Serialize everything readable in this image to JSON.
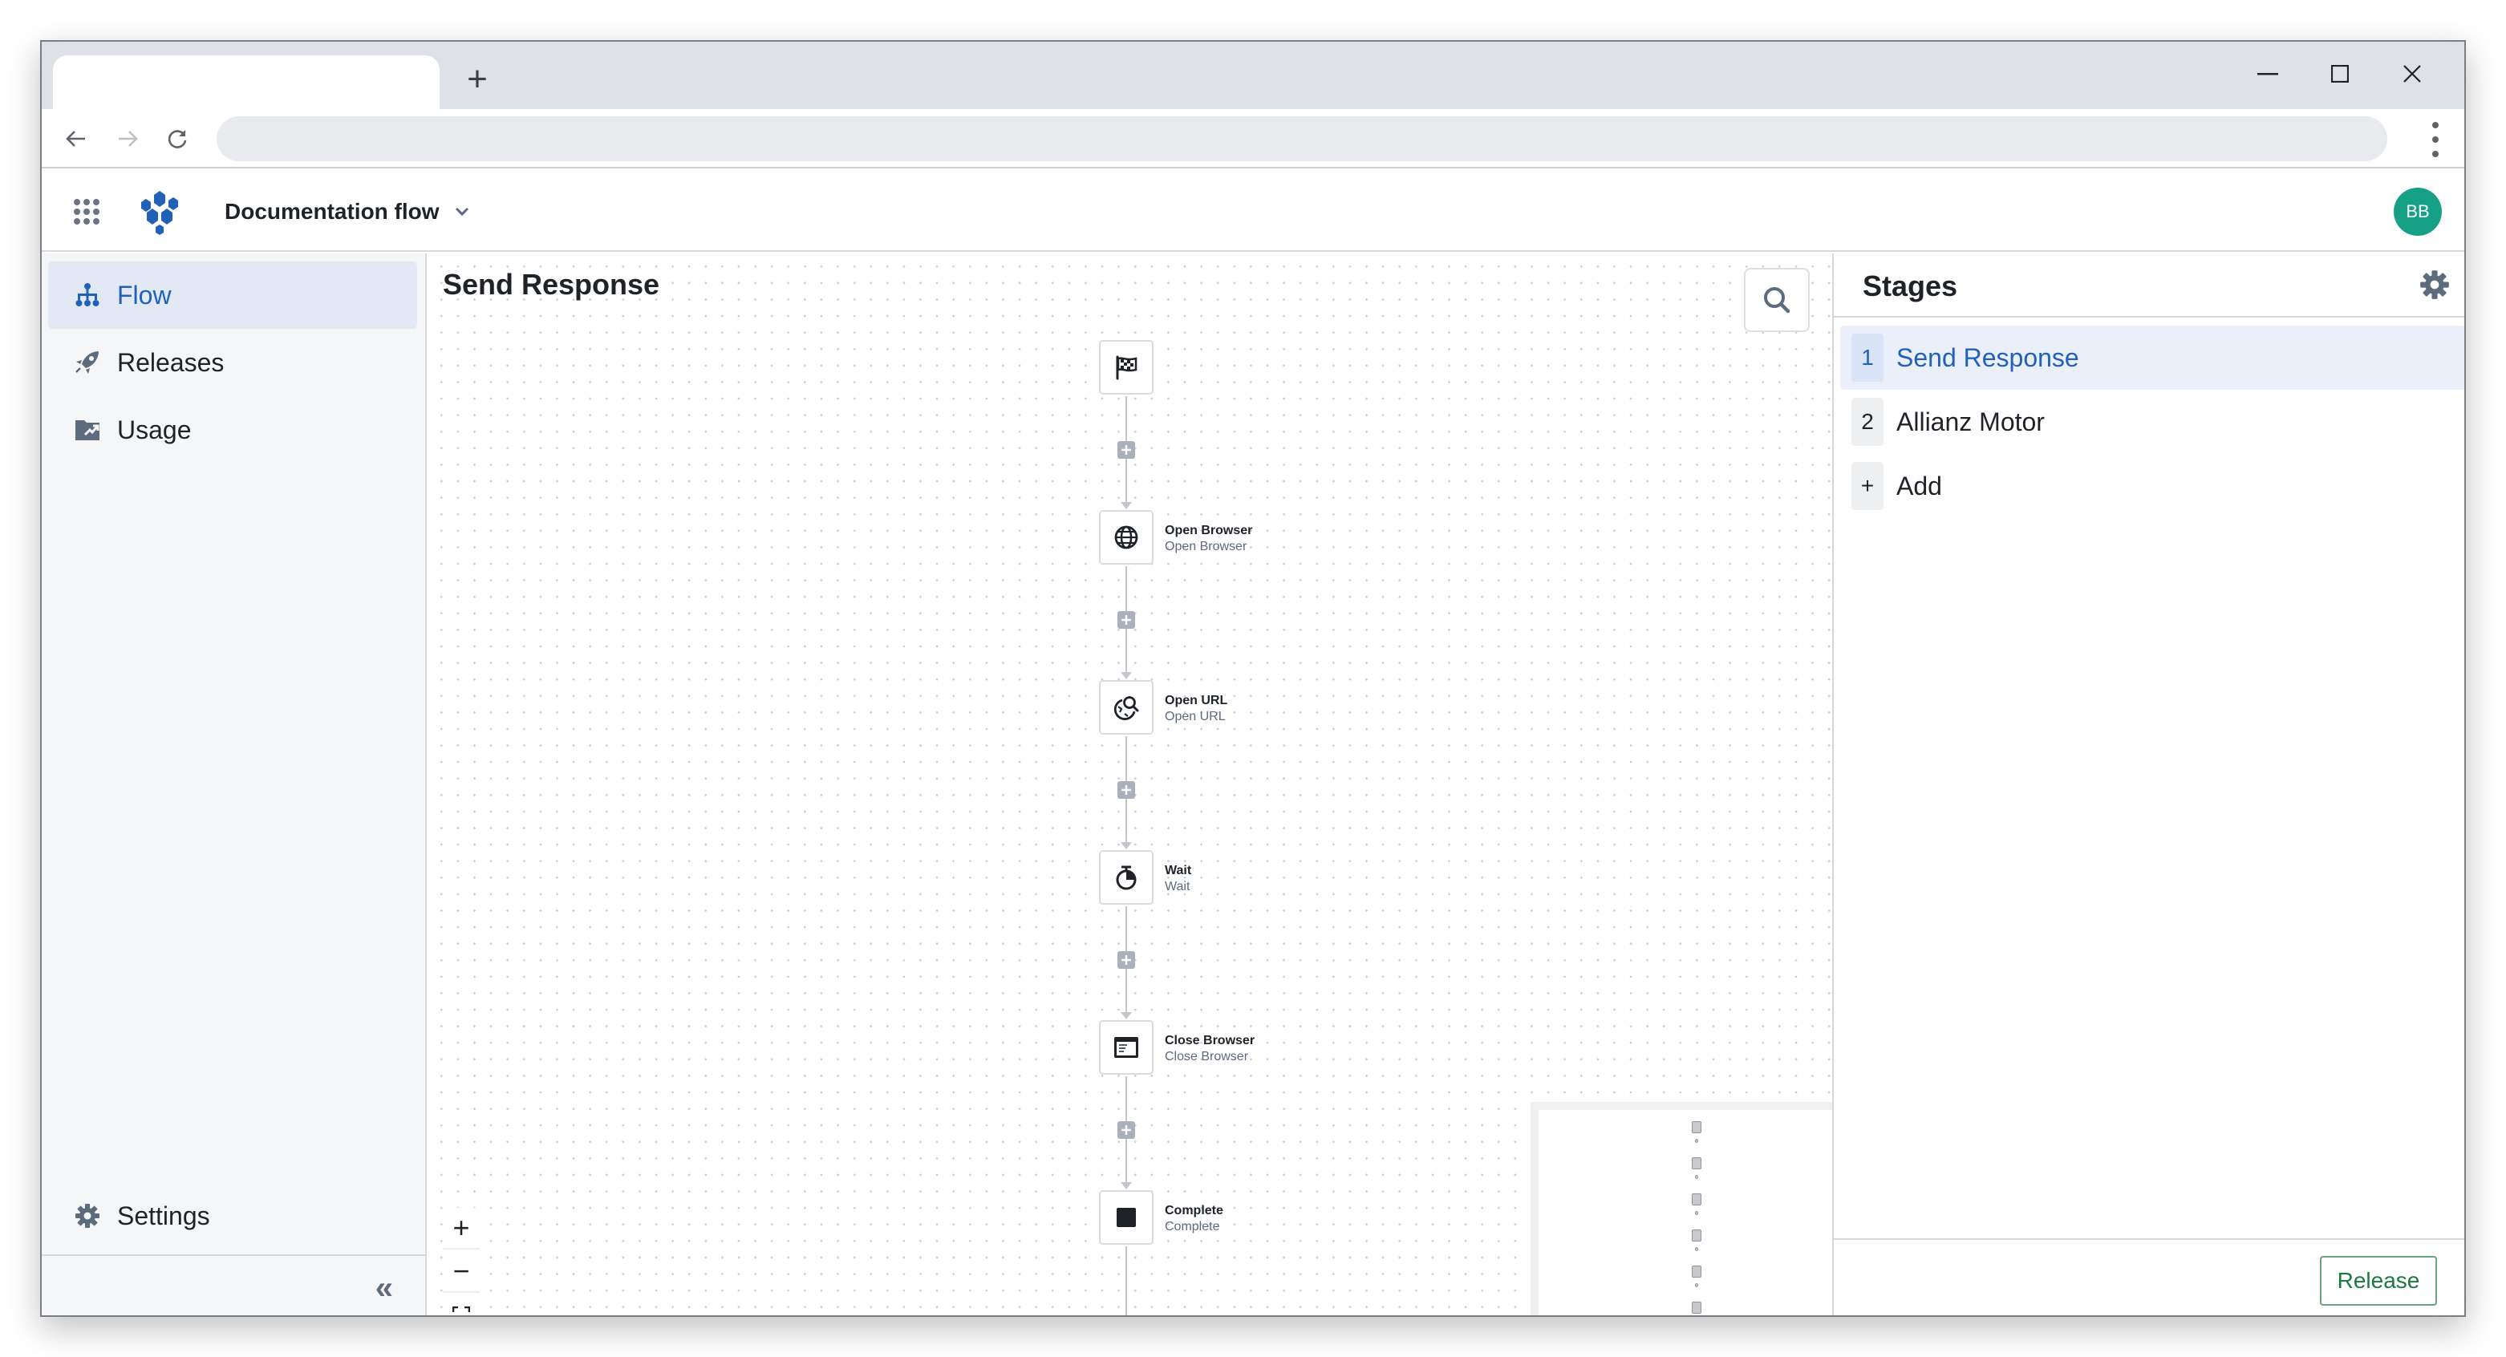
{
  "browser": {
    "tab_title": "",
    "new_tab_label": "+",
    "url": ""
  },
  "header": {
    "flow_name": "Documentation flow",
    "avatar_initials": "BB",
    "avatar_color": "#16a085",
    "brand_color": "#2261b8"
  },
  "sidebar": {
    "items": [
      {
        "label": "Flow",
        "icon": "sitemap-icon",
        "active": true
      },
      {
        "label": "Releases",
        "icon": "rocket-icon",
        "active": false
      },
      {
        "label": "Usage",
        "icon": "usage-chart-icon",
        "active": false
      }
    ],
    "settings_label": "Settings",
    "collapse_label": "«"
  },
  "canvas": {
    "title": "Send Response",
    "nodes": [
      {
        "type": "start",
        "icon": "checkered-flag-icon",
        "title": "",
        "subtitle": ""
      },
      {
        "type": "action",
        "icon": "globe-icon",
        "title": "Open Browser",
        "subtitle": "Open Browser"
      },
      {
        "type": "action",
        "icon": "globe-search-icon",
        "title": "Open URL",
        "subtitle": "Open URL"
      },
      {
        "type": "action",
        "icon": "stopwatch-icon",
        "title": "Wait",
        "subtitle": "Wait"
      },
      {
        "type": "action",
        "icon": "browser-window-icon",
        "title": "Close Browser",
        "subtitle": "Close Browser"
      },
      {
        "type": "end",
        "icon": "stop-square-icon",
        "title": "Complete",
        "subtitle": "Complete"
      }
    ],
    "zoom_controls": {
      "zoom_in": "+",
      "zoom_out": "−",
      "fit": "fit-view"
    }
  },
  "stages_panel": {
    "title": "Stages",
    "stages": [
      {
        "number": "1",
        "label": "Send Response",
        "active": true
      },
      {
        "number": "2",
        "label": "Allianz Motor",
        "active": false
      }
    ],
    "add": {
      "symbol": "+",
      "label": "Add"
    },
    "release_label": "Release"
  }
}
